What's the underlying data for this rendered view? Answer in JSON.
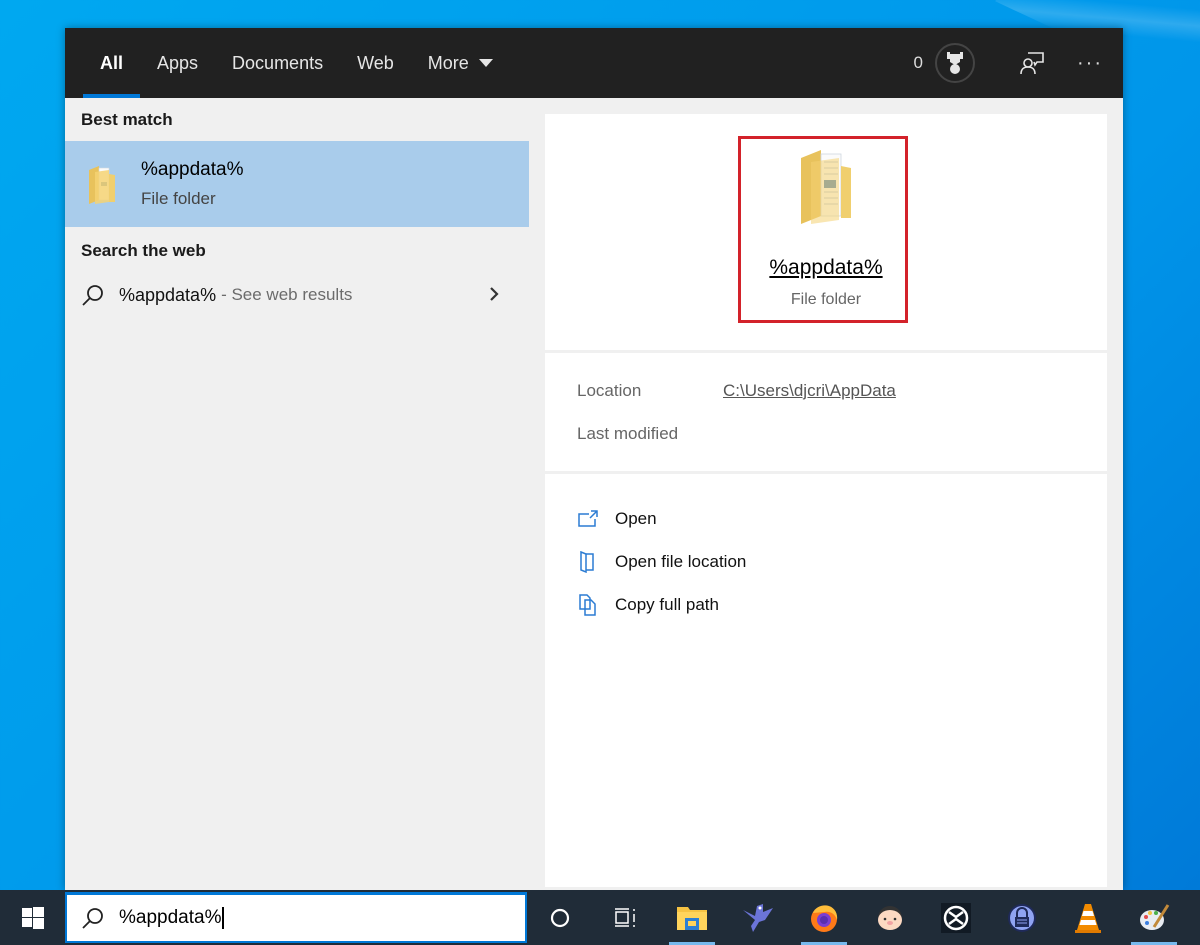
{
  "header": {
    "tabs": [
      {
        "label": "All",
        "active": true
      },
      {
        "label": "Apps",
        "active": false
      },
      {
        "label": "Documents",
        "active": false
      },
      {
        "label": "Web",
        "active": false
      },
      {
        "label": "More",
        "active": false,
        "has_dropdown": true
      }
    ],
    "points": "0",
    "icons": {
      "rewards": "trophy-icon",
      "feedback": "feedback-icon",
      "more": "ellipsis-icon"
    }
  },
  "results": {
    "best_match_header": "Best match",
    "best_match": {
      "title": "%appdata%",
      "subtitle": "File folder",
      "icon": "folder-icon"
    },
    "web_header": "Search the web",
    "web_item": {
      "query": "%appdata%",
      "suffix": "- See web results",
      "icon": "search-icon"
    }
  },
  "preview": {
    "title": "%appdata%",
    "subtitle": "File folder",
    "highlight_color": "#d3222a",
    "details": [
      {
        "label": "Location",
        "value": "C:\\Users\\djcri\\AppData"
      },
      {
        "label": "Last modified",
        "value": ""
      }
    ],
    "actions": [
      {
        "label": "Open",
        "icon": "open-icon"
      },
      {
        "label": "Open file location",
        "icon": "file-location-icon"
      },
      {
        "label": "Copy full path",
        "icon": "copy-icon"
      }
    ]
  },
  "taskbar": {
    "search_value": "%appdata%",
    "pinned": [
      {
        "name": "cortana",
        "icon": "cortana-circle-icon",
        "running": false
      },
      {
        "name": "task-view",
        "icon": "task-view-icon",
        "running": false
      },
      {
        "name": "file-explorer",
        "icon": "file-explorer-icon",
        "running": true
      },
      {
        "name": "inkscape-like-bird",
        "icon": "bird-app-icon",
        "running": false
      },
      {
        "name": "firefox",
        "icon": "firefox-icon",
        "running": true
      },
      {
        "name": "pidgin-like-face",
        "icon": "face-app-icon",
        "running": false
      },
      {
        "name": "circle-x-app",
        "icon": "circle-x-app-icon",
        "running": false
      },
      {
        "name": "keepass",
        "icon": "lock-app-icon",
        "running": false
      },
      {
        "name": "vlc",
        "icon": "vlc-cone-icon",
        "running": false
      },
      {
        "name": "paint",
        "icon": "paint-palette-icon",
        "running": true
      }
    ]
  },
  "colors": {
    "accent": "#0078d7",
    "selection": "#a9cceb",
    "topbar": "#212121",
    "taskbar": "#202c38"
  }
}
